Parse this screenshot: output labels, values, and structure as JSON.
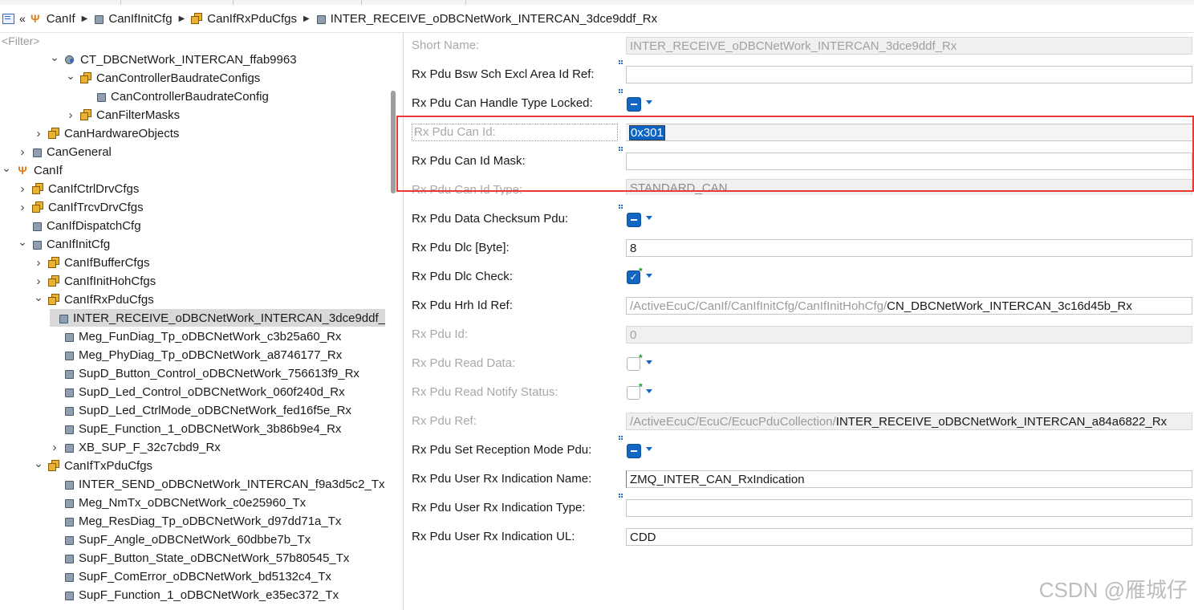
{
  "breadcrumb": [
    {
      "label": "CanIf",
      "icon": "canif-icon"
    },
    {
      "label": "CanIfInitCfg",
      "icon": "container-icon"
    },
    {
      "label": "CanIfRxPduCfgs",
      "icon": "container-list-icon"
    },
    {
      "label": "INTER_RECEIVE_oDBCNetWork_INTERCAN_3dce9ddf_Rx",
      "icon": "container-icon"
    }
  ],
  "filter_placeholder": "<Filter>",
  "tree": [
    {
      "label": "CT_DBCNetWork_INTERCAN_ffab9963",
      "twisty": "open",
      "icon": "node",
      "level": 3
    },
    {
      "label": "CanControllerBaudrateConfigs",
      "twisty": "open",
      "icon": "cubes",
      "level": 4
    },
    {
      "label": "CanControllerBaudrateConfig",
      "twisty": "none",
      "icon": "cube",
      "level": 5
    },
    {
      "label": "CanFilterMasks",
      "twisty": "closed",
      "icon": "cubes",
      "level": 4
    },
    {
      "label": "CanHardwareObjects",
      "twisty": "closed",
      "icon": "cubes",
      "level": 2
    },
    {
      "label": "CanGeneral",
      "twisty": "closed",
      "icon": "cube",
      "level": 1
    },
    {
      "label": "CanIf",
      "twisty": "open",
      "icon": "fork",
      "level": 0
    },
    {
      "label": "CanIfCtrlDrvCfgs",
      "twisty": "closed",
      "icon": "cubes",
      "level": 1
    },
    {
      "label": "CanIfTrcvDrvCfgs",
      "twisty": "closed",
      "icon": "cubes",
      "level": 1
    },
    {
      "label": "CanIfDispatchCfg",
      "twisty": "none",
      "icon": "cube",
      "level": 1
    },
    {
      "label": "CanIfInitCfg",
      "twisty": "open",
      "icon": "cube",
      "level": 1
    },
    {
      "label": "CanIfBufferCfgs",
      "twisty": "closed",
      "icon": "cubes",
      "level": 2
    },
    {
      "label": "CanIfInitHohCfgs",
      "twisty": "closed",
      "icon": "cubes",
      "level": 2
    },
    {
      "label": "CanIfRxPduCfgs",
      "twisty": "open",
      "icon": "cubes",
      "level": 2
    },
    {
      "label": "INTER_RECEIVE_oDBCNetWork_INTERCAN_3dce9ddf_",
      "twisty": "none",
      "icon": "cube",
      "level": 3,
      "selected": true
    },
    {
      "label": "Meg_FunDiag_Tp_oDBCNetWork_c3b25a60_Rx",
      "twisty": "none",
      "icon": "cube",
      "level": 3
    },
    {
      "label": "Meg_PhyDiag_Tp_oDBCNetWork_a8746177_Rx",
      "twisty": "none",
      "icon": "cube",
      "level": 3
    },
    {
      "label": "SupD_Button_Control_oDBCNetWork_756613f9_Rx",
      "twisty": "none",
      "icon": "cube",
      "level": 3
    },
    {
      "label": "SupD_Led_Control_oDBCNetWork_060f240d_Rx",
      "twisty": "none",
      "icon": "cube",
      "level": 3
    },
    {
      "label": "SupD_Led_CtrlMode_oDBCNetWork_fed16f5e_Rx",
      "twisty": "none",
      "icon": "cube",
      "level": 3
    },
    {
      "label": "SupE_Function_1_oDBCNetWork_3b86b9e4_Rx",
      "twisty": "none",
      "icon": "cube",
      "level": 3
    },
    {
      "label": "XB_SUP_F_32c7cbd9_Rx",
      "twisty": "closed",
      "icon": "cube",
      "level": 3
    },
    {
      "label": "CanIfTxPduCfgs",
      "twisty": "open",
      "icon": "cubes",
      "level": 2
    },
    {
      "label": "INTER_SEND_oDBCNetWork_INTERCAN_f9a3d5c2_Tx",
      "twisty": "none",
      "icon": "cube",
      "level": 3
    },
    {
      "label": "Meg_NmTx_oDBCNetWork_c0e25960_Tx",
      "twisty": "none",
      "icon": "cube",
      "level": 3
    },
    {
      "label": "Meg_ResDiag_Tp_oDBCNetWork_d97dd71a_Tx",
      "twisty": "none",
      "icon": "cube",
      "level": 3
    },
    {
      "label": "SupF_Angle_oDBCNetWork_60dbbe7b_Tx",
      "twisty": "none",
      "icon": "cube",
      "level": 3
    },
    {
      "label": "SupF_Button_State_oDBCNetWork_57b80545_Tx",
      "twisty": "none",
      "icon": "cube",
      "level": 3
    },
    {
      "label": "SupF_ComError_oDBCNetWork_bd5132c4_Tx",
      "twisty": "none",
      "icon": "cube",
      "level": 3
    },
    {
      "label": "SupF_Function_1_oDBCNetWork_e35ec372_Tx",
      "twisty": "none",
      "icon": "cube",
      "level": 3
    }
  ],
  "form": {
    "short_name": {
      "label": "Short Name:",
      "value": "INTER_RECEIVE_oDBCNetWork_INTERCAN_3dce9ddf_Rx"
    },
    "bsw_sch": {
      "label": "Rx Pdu Bsw Sch Excl Area Id Ref:",
      "value": ""
    },
    "can_handle_type_locked": {
      "label": "Rx Pdu Can Handle Type Locked:"
    },
    "can_id": {
      "label": "Rx Pdu Can Id:",
      "value": "0x301"
    },
    "can_id_mask": {
      "label": "Rx Pdu Can Id Mask:",
      "value": ""
    },
    "can_id_type": {
      "label": "Rx Pdu Can Id Type:",
      "value": "STANDARD_CAN"
    },
    "data_checksum_pdu": {
      "label": "Rx Pdu Data Checksum Pdu:"
    },
    "dlc": {
      "label": "Rx Pdu Dlc [Byte]:",
      "value": "8"
    },
    "dlc_check": {
      "label": "Rx Pdu Dlc Check:",
      "checked": true
    },
    "hrh_id_ref": {
      "label": "Rx Pdu Hrh Id Ref:",
      "path": "/ActiveEcuC/CanIf/CanIfInitCfg/CanIfInitHohCfg/",
      "target": "CN_DBCNetWork_INTERCAN_3c16d45b_Rx"
    },
    "pdu_id": {
      "label": "Rx Pdu Id:",
      "value": "0"
    },
    "read_data": {
      "label": "Rx Pdu Read Data:",
      "checked": false
    },
    "read_notify_status": {
      "label": "Rx Pdu Read Notify Status:",
      "checked": false
    },
    "pdu_ref": {
      "label": "Rx Pdu Ref:",
      "path": "/ActiveEcuC/EcuC/EcucPduCollection/",
      "target": "INTER_RECEIVE_oDBCNetWork_INTERCAN_a84a6822_Rx"
    },
    "set_reception_mode": {
      "label": "Rx Pdu Set Reception Mode Pdu:"
    },
    "indication_name": {
      "label": "Rx Pdu User Rx Indication Name:",
      "value": "ZMQ_INTER_CAN_RxIndication"
    },
    "indication_type": {
      "label": "Rx Pdu User Rx Indication Type:",
      "value": ""
    },
    "indication_ul": {
      "label": "Rx Pdu User Rx Indication UL:",
      "value": "CDD"
    }
  },
  "checkmark_glyph": "✓",
  "star_glyph": "*",
  "watermark": "CSDN @雁城仔",
  "colors": {
    "accent": "#1366c4",
    "highlight_box": "#e53935",
    "selection": "#0a64c6"
  }
}
